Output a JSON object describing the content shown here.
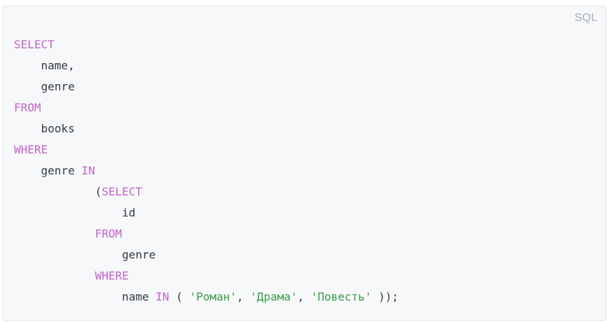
{
  "code_block": {
    "language": "SQL",
    "colors": {
      "keyword": "#c264c8",
      "string": "#3a9b45",
      "identifier": "#333a40",
      "label": "#a6adb5",
      "background": "#f6f8fa"
    },
    "lines": [
      {
        "indent": "",
        "tokens": [
          {
            "type": "kw",
            "text": "SELECT"
          }
        ]
      },
      {
        "indent": "    ",
        "tokens": [
          {
            "type": "ident",
            "text": "name,"
          }
        ]
      },
      {
        "indent": "    ",
        "tokens": [
          {
            "type": "ident",
            "text": "genre"
          }
        ]
      },
      {
        "indent": "",
        "tokens": [
          {
            "type": "kw",
            "text": "FROM"
          }
        ]
      },
      {
        "indent": "    ",
        "tokens": [
          {
            "type": "ident",
            "text": "books"
          }
        ]
      },
      {
        "indent": "",
        "tokens": [
          {
            "type": "kw",
            "text": "WHERE"
          }
        ]
      },
      {
        "indent": "    ",
        "tokens": [
          {
            "type": "ident",
            "text": "genre "
          },
          {
            "type": "kw",
            "text": "IN"
          }
        ]
      },
      {
        "indent": "            ",
        "tokens": [
          {
            "type": "punc",
            "text": "("
          },
          {
            "type": "kw",
            "text": "SELECT"
          }
        ]
      },
      {
        "indent": "                ",
        "tokens": [
          {
            "type": "ident",
            "text": "id"
          }
        ]
      },
      {
        "indent": "            ",
        "tokens": [
          {
            "type": "kw",
            "text": "FROM"
          }
        ]
      },
      {
        "indent": "                ",
        "tokens": [
          {
            "type": "ident",
            "text": "genre"
          }
        ]
      },
      {
        "indent": "            ",
        "tokens": [
          {
            "type": "kw",
            "text": "WHERE"
          }
        ]
      },
      {
        "indent": "                ",
        "tokens": [
          {
            "type": "ident",
            "text": "name "
          },
          {
            "type": "kw",
            "text": "IN"
          },
          {
            "type": "punc",
            "text": " ( "
          },
          {
            "type": "str",
            "text": "'Роман'"
          },
          {
            "type": "punc",
            "text": ", "
          },
          {
            "type": "str",
            "text": "'Драма'"
          },
          {
            "type": "punc",
            "text": ", "
          },
          {
            "type": "str",
            "text": "'Повесть'"
          },
          {
            "type": "punc",
            "text": " ));"
          }
        ]
      }
    ]
  }
}
